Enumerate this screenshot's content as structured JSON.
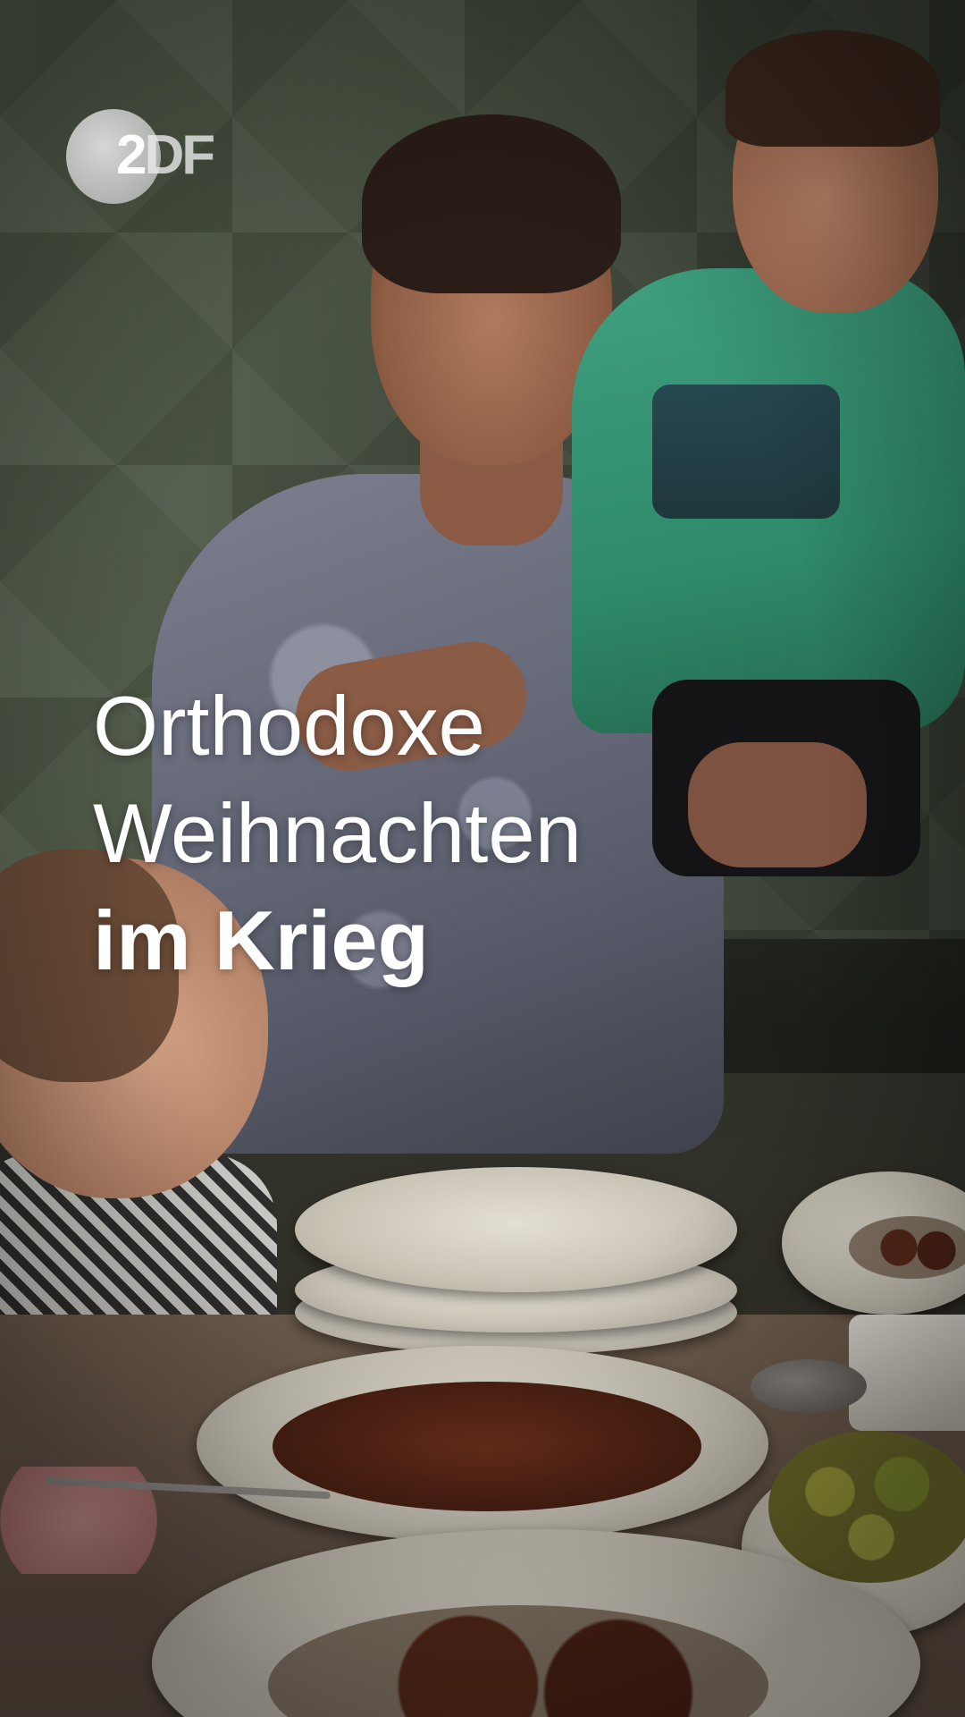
{
  "logo": {
    "text_part1": "2",
    "text_part2": "DF",
    "icon": "zdf-logo-icon"
  },
  "headline": {
    "line1": "Orthodoxe",
    "line2": "Weihnachten",
    "line3": "im Krieg"
  },
  "colors": {
    "headline_text": "#ffffff",
    "shirt_green": "#3fa07f"
  }
}
